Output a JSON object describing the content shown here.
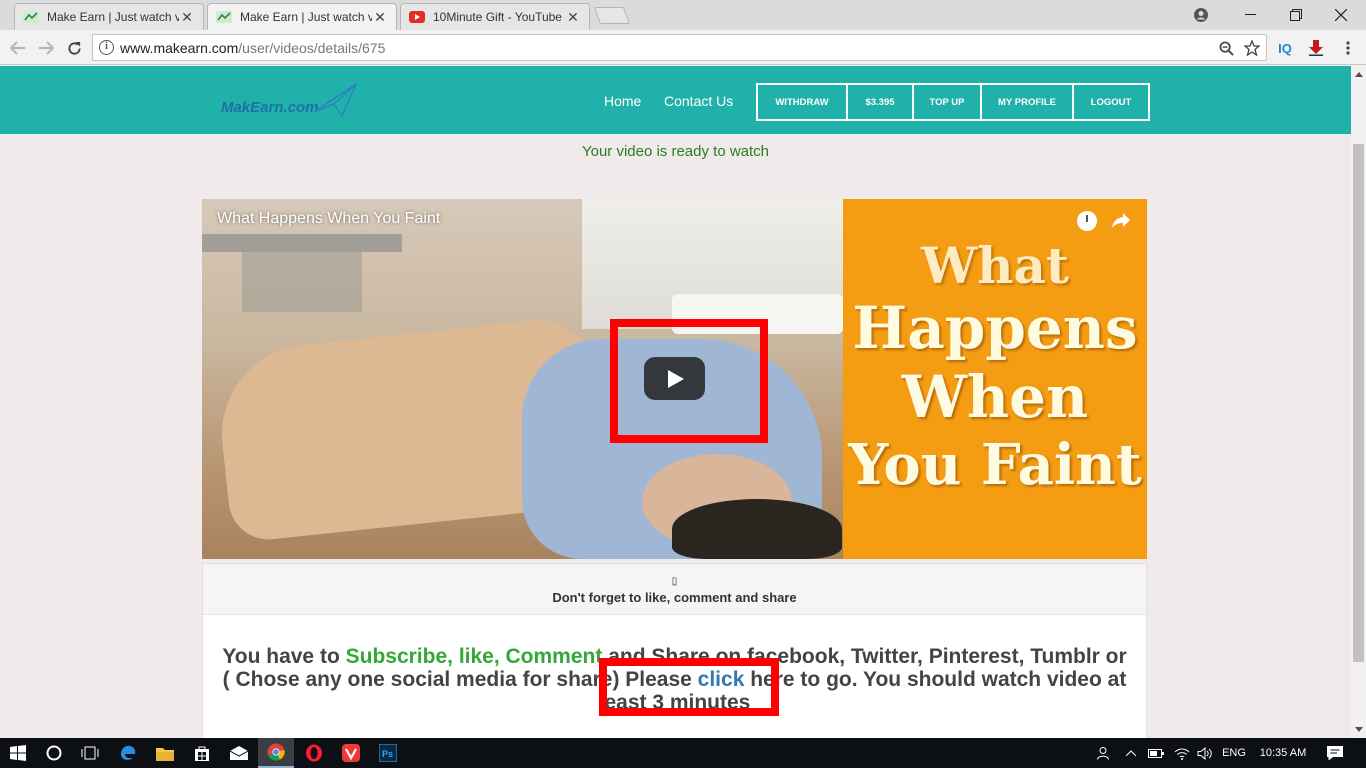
{
  "browser": {
    "tabs": [
      {
        "title": "Make Earn | Just watch vi",
        "favicon": "makeearn-favicon",
        "active": false
      },
      {
        "title": "Make Earn | Just watch vi",
        "favicon": "makeearn-favicon",
        "active": true
      },
      {
        "title": "10Minute Gift - YouTube",
        "favicon": "youtube-favicon",
        "active": false
      }
    ],
    "url_host": "www.makearn.com",
    "url_path": "/user/videos/details/675",
    "extensions": [
      "IQ",
      "download-icon",
      "menu-icon"
    ]
  },
  "site": {
    "logo": "MakEarn.com",
    "nav": {
      "home": "Home",
      "contact": "Contact Us"
    },
    "buttons": {
      "withdraw": "WITHDRAW",
      "balance": "$3.395",
      "topup": "TOP UP",
      "profile": "MY PROFILE",
      "logout": "LOGOUT"
    }
  },
  "content": {
    "ready_message": "Your video is ready to watch",
    "video": {
      "title": "What Happens When You Faint",
      "thumb_line1": "What",
      "thumb_line2": "Happens",
      "thumb_line3": "When",
      "thumb_line4": "You Faint"
    },
    "card": {
      "icon_glyph": "▯",
      "note": "Don't forget to like, comment and share",
      "text_1": "You have to ",
      "text_green": "Subscribe, like, Comment",
      "text_2": " and Share on facebook, Twitter, Pinterest, Tumblr or ( Chose any one social media for share) Please ",
      "text_link": "click",
      "text_3": " here to go. You should watch video at least 3 minutes"
    }
  },
  "taskbar": {
    "language": "ENG",
    "time": "10:35 AM"
  },
  "colors": {
    "header": "#20b2aa",
    "ready_text": "#2a7d23",
    "highlight": "#ff0000",
    "thumb_panel": "#f49c12"
  }
}
